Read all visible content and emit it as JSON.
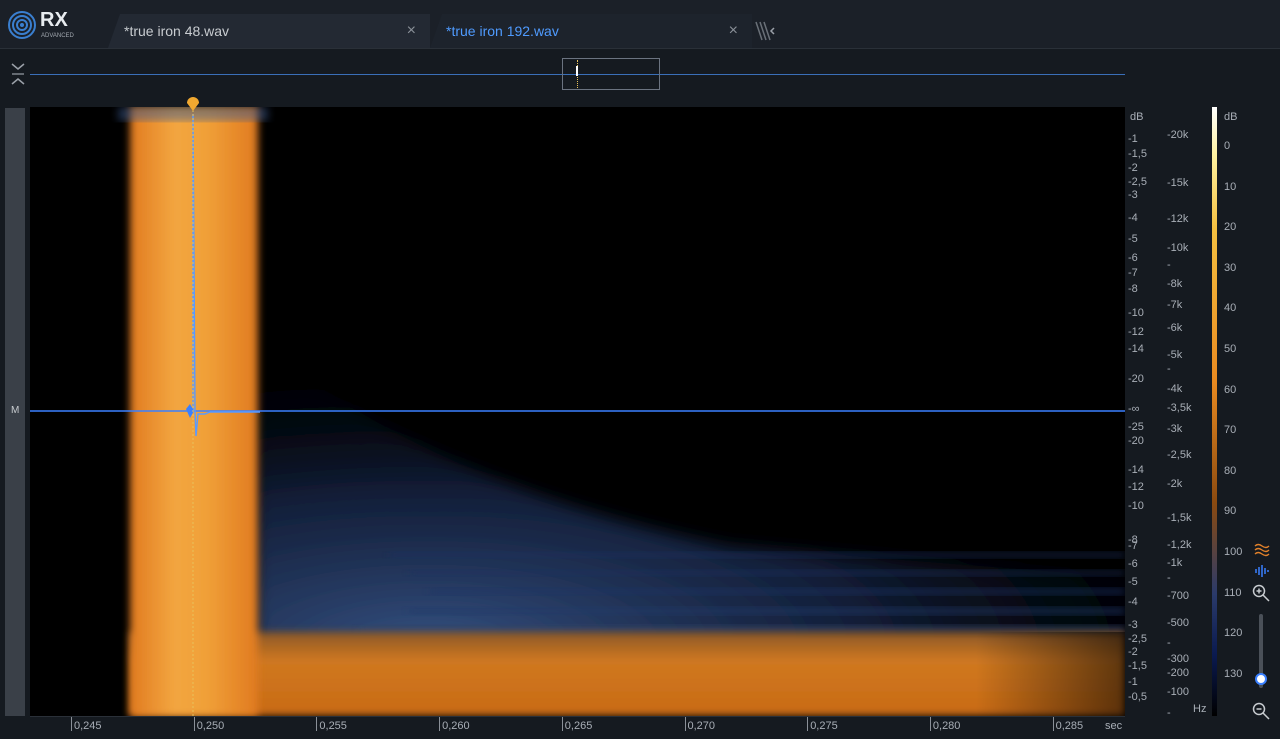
{
  "app": {
    "logo_text": "RX",
    "logo_sub": "ADVANCED"
  },
  "tabs": [
    {
      "label": "*true iron 48.wav",
      "close": "×"
    },
    {
      "label": "*true iron 192.wav",
      "close": "×"
    }
  ],
  "channel": {
    "label": "M"
  },
  "colors": {
    "accent": "#4f9bff",
    "playhead": "#e8b040",
    "waveform": "#3a80ff"
  },
  "db_axis": {
    "unit": "dB",
    "upper": [
      "-1",
      "-1,5",
      "-2",
      "-2,5",
      "-3",
      "-4",
      "-5",
      "-6",
      "-7",
      "-8",
      "-10",
      "-12",
      "-14",
      "-20"
    ],
    "center": "-∞",
    "lower": [
      "-25",
      "-20",
      "-14",
      "-12",
      "-10",
      "-8",
      "-7",
      "-6",
      "-5",
      "-4",
      "-3",
      "-2,5",
      "-2",
      "-1,5",
      "-1",
      "-0,5"
    ]
  },
  "freq_axis": {
    "unit": "Hz",
    "labels": [
      "-20k",
      "-15k",
      "-12k",
      "-10k",
      "-",
      "-8k",
      "-7k",
      "-6k",
      "-5k",
      "-",
      "-4k",
      "-3,5k",
      "-3k",
      "-2,5k",
      "-2k",
      "-1,5k",
      "-1,2k",
      "-1k",
      "-",
      "-700",
      "-500",
      "-",
      "-300",
      "-200",
      "-100",
      "-"
    ]
  },
  "color_scale": {
    "unit": "dB",
    "labels": [
      "0",
      "10",
      "20",
      "30",
      "40",
      "50",
      "60",
      "70",
      "80",
      "90",
      "100",
      "110",
      "120",
      "130"
    ]
  },
  "time_axis": {
    "unit": "sec",
    "labels": [
      "0,245",
      "0,250",
      "0,255",
      "0,260",
      "0,265",
      "0,270",
      "0,275",
      "0,280",
      "0,285"
    ]
  }
}
